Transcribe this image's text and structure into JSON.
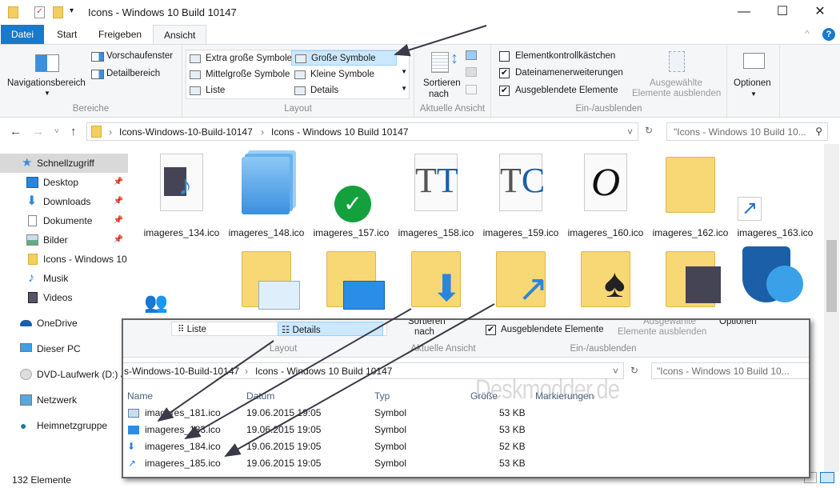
{
  "window": {
    "title": "Icons - Windows 10 Build 10147",
    "minimize": "—",
    "maximize": "☐",
    "close": "✕",
    "help": "?",
    "collapse": "^"
  },
  "tabs": [
    "Datei",
    "Start",
    "Freigeben",
    "Ansicht"
  ],
  "ribbon": {
    "bereiche": {
      "nav": "Navigationsbereich",
      "preview": "Vorschaufenster",
      "details": "Detailbereich",
      "label": "Bereiche"
    },
    "layout": {
      "items": [
        "Extra große Symbole",
        "Große Symbole",
        "Mittelgroße Symbole",
        "Kleine Symbole",
        "Liste",
        "Details"
      ],
      "selected": "Große Symbole",
      "label": "Layout"
    },
    "view": {
      "sort": "Sortieren",
      "sort2": "nach",
      "label": "Aktuelle Ansicht"
    },
    "show": {
      "items": [
        {
          "label": "Elementkontrollkästchen",
          "checked": false
        },
        {
          "label": "Dateinamenerweiterungen",
          "checked": true
        },
        {
          "label": "Ausgeblendete Elemente",
          "checked": true
        }
      ],
      "hide1": "Ausgewählte",
      "hide2": "Elemente ausblenden",
      "label": "Ein-/ausblenden"
    },
    "options": "Optionen"
  },
  "address": {
    "crumbs": [
      "Icons-Windows-10-Build-10147",
      "Icons - Windows 10 Build 10147"
    ],
    "search_placeholder": "\"Icons - Windows 10 Build 10...",
    "back": "←",
    "forward": "→",
    "recent": "˅",
    "up": "↑",
    "refresh": "↻",
    "dropdown": "˅",
    "search_icon": "⚲"
  },
  "nav": {
    "items": [
      {
        "label": "Schnellzugriff",
        "sel": true
      },
      {
        "label": "Desktop",
        "pin": true
      },
      {
        "label": "Downloads",
        "pin": true
      },
      {
        "label": "Dokumente",
        "pin": true
      },
      {
        "label": "Bilder",
        "pin": true
      },
      {
        "label": "Icons - Windows 10"
      },
      {
        "label": "Musik"
      },
      {
        "label": "Videos"
      },
      {
        "label": "OneDrive"
      },
      {
        "label": "Dieser PC"
      },
      {
        "label": "DVD-Laufwerk (D:) J"
      },
      {
        "label": "Netzwerk"
      },
      {
        "label": "Heimnetzgruppe"
      }
    ]
  },
  "files": [
    "imageres_134.ico",
    "imageres_148.ico",
    "imageres_157.ico",
    "imageres_158.ico",
    "imageres_159.ico",
    "imageres_160.ico",
    "imageres_162.ico",
    "imageres_163.ico"
  ],
  "status": "132 Elemente",
  "inset": {
    "layout": {
      "list": "Liste",
      "details": "Details",
      "label": "Layout"
    },
    "view": {
      "sort": "Sortieren",
      "sort2": "nach",
      "label": "Aktuelle Ansicht"
    },
    "show": {
      "hidden": "Ausgeblendete Elemente",
      "hide1": "Ausgewählte",
      "hide2": "Elemente ausblenden",
      "label": "Ein-/ausblenden"
    },
    "options": "Optionen",
    "crumbs": [
      "s-Windows-10-Build-10147",
      "Icons - Windows 10 Build 10147"
    ],
    "search": "\"Icons - Windows 10 Build 10...",
    "columns": [
      "Name",
      "Datum",
      "Typ",
      "Größe",
      "Markierungen"
    ],
    "rows": [
      {
        "name": "imageres_181.ico",
        "date": "19.06.2015 19:05",
        "type": "Symbol",
        "size": "53 KB"
      },
      {
        "name": "imageres_183.ico",
        "date": "19.06.2015 19:05",
        "type": "Symbol",
        "size": "53 KB"
      },
      {
        "name": "imageres_184.ico",
        "date": "19.06.2015 19:05",
        "type": "Symbol",
        "size": "52 KB"
      },
      {
        "name": "imageres_185.ico",
        "date": "19.06.2015 19:05",
        "type": "Symbol",
        "size": "53 KB"
      }
    ],
    "watermark": "Deskmodder.de"
  }
}
